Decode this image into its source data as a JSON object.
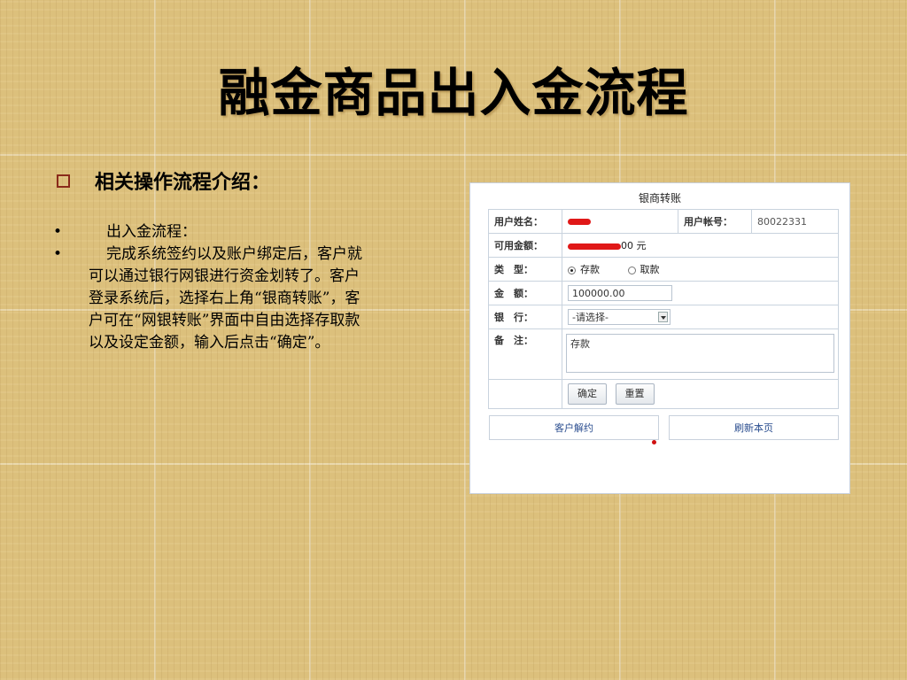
{
  "slide": {
    "title": "融金商品出入金流程",
    "subhead": "相关操作流程介绍：",
    "bullets": [
      {
        "marker": "•",
        "text": "出入金流程："
      },
      {
        "marker": "•",
        "text": "完成系统签约以及账户绑定后，客户就可以通过银行网银进行资金划转了。客户登录系统后，选择右上角“银商转账”，客户可在“网银转账”界面中自由选择存取款以及设定金额，输入后点击“确定”。"
      }
    ]
  },
  "panel": {
    "title": "银商转账",
    "labels": {
      "user_name": "用户姓名：",
      "user_account": "用户帐号：",
      "available": "可用金额：",
      "type": "类　型：",
      "amount": "金　额：",
      "bank": "银　行：",
      "note": "备　注："
    },
    "values": {
      "account_number": "80022331",
      "available_suffix": "00 元",
      "amount": "100000.00",
      "bank_selected": "-请选择-",
      "note": "存款"
    },
    "radios": {
      "deposit": "存款",
      "withdraw": "取款",
      "selected": "deposit"
    },
    "buttons": {
      "confirm": "确定",
      "reset": "重置",
      "terminate": "客户解约",
      "refresh": "刷新本页"
    }
  }
}
